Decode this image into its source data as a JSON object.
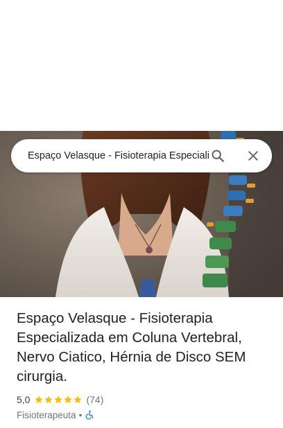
{
  "search": {
    "value": "Espaço Velasque - Fisioterapia Especializada em Coluna Vertebral, Nervo Ciatico, Hérnia de Disco SEM cirurgia.",
    "search_icon": "search-icon",
    "close_icon": "close-icon"
  },
  "place": {
    "title": "Espaço Velasque - Fisioterapia Especializada em Coluna Vertebral, Nervo Ciatico, Hérnia de Disco SEM cirurgia.",
    "rating": "5,0",
    "rating_stars": 5,
    "review_count": "(74)",
    "category": "Fisioterapeuta",
    "separator": "•",
    "accessibility_icon": "wheelchair-icon"
  },
  "colors": {
    "star": "#fbbc04",
    "text_primary": "#202124",
    "text_secondary": "#70757a",
    "accessibility": "#1a73e8"
  }
}
